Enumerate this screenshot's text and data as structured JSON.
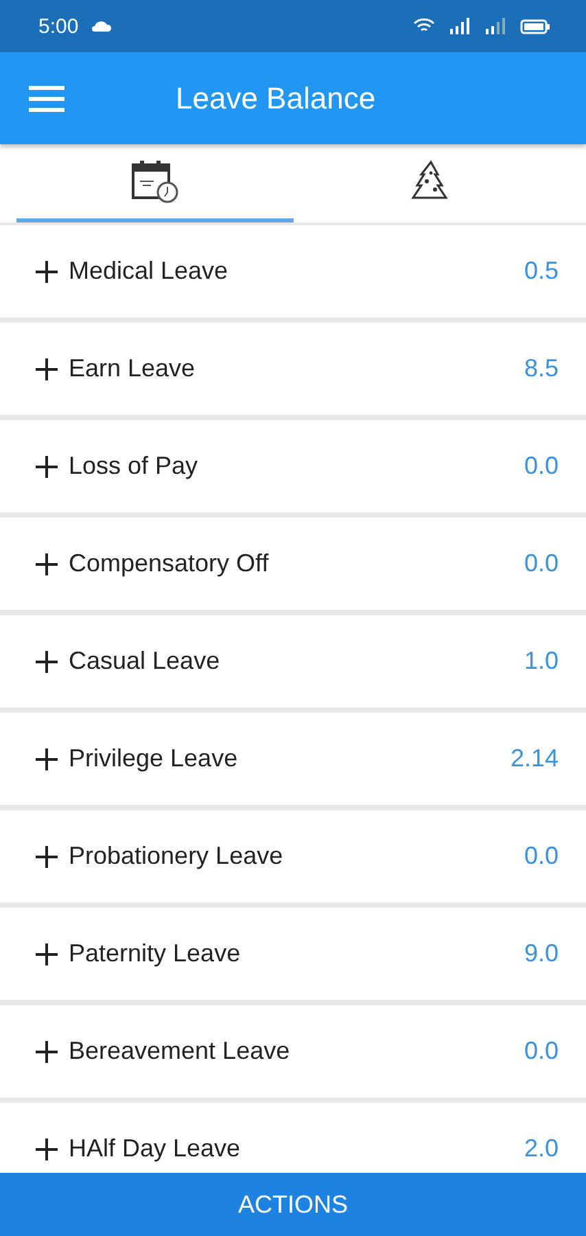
{
  "status_bar": {
    "time": "5:00"
  },
  "app_bar": {
    "title": "Leave Balance"
  },
  "tabs": [
    {
      "kind": "calendar",
      "selected": true
    },
    {
      "kind": "tree",
      "selected": false
    }
  ],
  "leaves": [
    {
      "name": "Medical Leave",
      "balance": "0.5"
    },
    {
      "name": "Earn Leave",
      "balance": "8.5"
    },
    {
      "name": "Loss of Pay",
      "balance": "0.0"
    },
    {
      "name": "Compensatory Off",
      "balance": "0.0"
    },
    {
      "name": "Casual Leave",
      "balance": "1.0"
    },
    {
      "name": "Privilege Leave",
      "balance": "2.14"
    },
    {
      "name": "Probationery Leave",
      "balance": "0.0"
    },
    {
      "name": "Paternity Leave",
      "balance": "9.0"
    },
    {
      "name": "Bereavement Leave",
      "balance": "0.0"
    },
    {
      "name": "HAlf Day Leave",
      "balance": "2.0"
    }
  ],
  "actions_button": "ACTIONS"
}
